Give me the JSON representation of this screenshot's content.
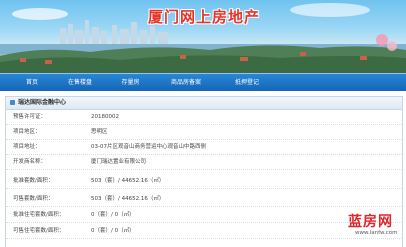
{
  "banner": {
    "title": "厦门网上房地产"
  },
  "nav": {
    "items": [
      "首页",
      "在售楼盘",
      "存量房",
      "商品房备案",
      "抵押登记"
    ]
  },
  "section": {
    "title": "瑞达国际金融中心",
    "rows": [
      {
        "label": "预售许可证：",
        "value": "20180002"
      },
      {
        "label": "项目地区：",
        "value": "思明区"
      },
      {
        "label": "项目地址：",
        "value": "03-07片区观音山商务营运中心观音山中路西侧"
      },
      {
        "label": "开发商名称：",
        "value": "厦门瑞达置业有限公司"
      },
      {
        "label": "批准套数/面积：",
        "value": "503（套）/ 44652.16（㎡）"
      },
      {
        "label": "可售套数/面积：",
        "value": "503（套）/ 44652.16（㎡）"
      },
      {
        "label": "批准住宅套数/面积：",
        "value": "0（套）/ 0（㎡）"
      },
      {
        "label": "可售住宅套数/面积：",
        "value": "0（套）/ 0（㎡）"
      }
    ]
  },
  "watermark": {
    "logo": "蓝房网",
    "url": "www.lanfw.com"
  },
  "colors": {
    "nav": "#1a6fc2",
    "title": "#e8332a",
    "watermark": "#e2252b"
  }
}
